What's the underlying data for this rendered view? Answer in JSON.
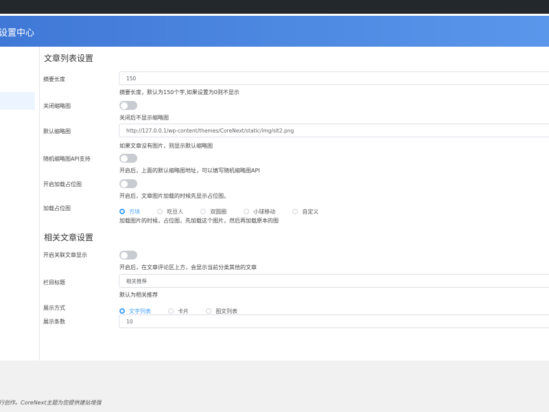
{
  "header": {
    "title": "设置中心"
  },
  "sections": {
    "article_list": {
      "title": "文章列表设置",
      "excerpt_length": {
        "label": "摘要长度",
        "value": "150",
        "hint": "摘要长度，默认为150个字,如果设置为0则不显示"
      },
      "close_thumbnail": {
        "label": "关闭缩略图",
        "enabled": false,
        "hint": "关闭后不显示缩略图"
      },
      "default_thumbnail": {
        "label": "默认缩略图",
        "value": "http://127.0.0.1/wp-content/themes/CoreNext/static/img/slt2.png",
        "hint": "如果文章没有图片，则显示默认缩略图"
      },
      "random_thumbnail_api": {
        "label": "随机缩略图API支持",
        "enabled": false,
        "hint": "开启后，上面的默认缩略图地址，可以填写随机缩略图API"
      },
      "lazy_placeholder": {
        "label": "开启加载占位图",
        "enabled": true,
        "hint": "开启后，文章图片加载的时候先显示占位图。"
      },
      "placeholder_style": {
        "label": "加载占位图",
        "options": [
          "方块",
          "吃豆人",
          "双圆圈",
          "小球移动",
          "自定义"
        ],
        "selected": "方块",
        "hint": "加载图片的时候，占位图，先加载这个图片，然后再加载原本的图"
      }
    },
    "related": {
      "title": "相关文章设置",
      "show_related": {
        "label": "开启关联文章显示",
        "enabled": true,
        "hint": "开启后，在文章评论区上方，会显示当前分类其他的文章"
      },
      "column_title": {
        "label": "栏目标题",
        "value": "相关推荐",
        "hint": "默认为相关推荐"
      },
      "display_mode": {
        "label": "展示方式",
        "options": [
          "文字列表",
          "卡片",
          "图文列表"
        ],
        "selected": "文字列表"
      },
      "display_count": {
        "label": "展示条数",
        "value": "10"
      }
    }
  },
  "footer": {
    "text": "行创作。CoreNext主题为您提供建站增强"
  },
  "colors": {
    "header_start": "#3f78d6",
    "header_end": "#5a97eb",
    "switch_on": "#13ce66",
    "radio_active": "#409eff"
  }
}
